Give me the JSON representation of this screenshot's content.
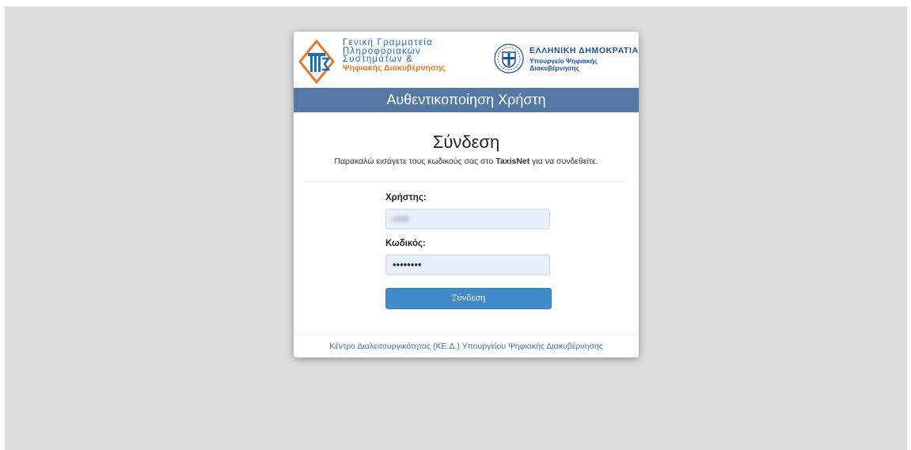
{
  "logos": {
    "gsis_lines": [
      "Γενική Γραμματεία",
      "Πληροφοριακών",
      "Συστημάτων &"
    ],
    "gsis_orange": "Ψηφιακής Διακυβέρνησης",
    "gr_title": "ΕΛΛΗΝΙΚΗ ΔΗΜΟΚΡΑΤΙΑ",
    "gr_sub_1": "Υπουργείο Ψηφιακής",
    "gr_sub_2": "Διακυβέρνησης"
  },
  "header": {
    "title": "Αυθεντικοποίηση Χρήστη"
  },
  "intro": {
    "heading": "Σύνδεση",
    "text_before": "Παρακαλώ εισάγετε τους κωδικούς σας στο ",
    "text_bold": "TaxisNet",
    "text_after": " για να συνδεθείτε."
  },
  "form": {
    "user_label": "Χρήστης:",
    "user_value": "user",
    "password_label": "Κωδικός:",
    "password_value": "••••••••",
    "submit_label": "Σύνδεση"
  },
  "footer": {
    "link": "Κέντρο Διαλειτουργικότητας (ΚΕ.Δ.) Υπουργείου Ψηφιακής Διακυβέρνησης"
  },
  "colors": {
    "header": "#5479a5",
    "button": "#428bca",
    "background": "#dddddd",
    "link": "#3f6fb0"
  },
  "icons": [
    "gsis-logo-icon",
    "greek-emblem-icon"
  ]
}
